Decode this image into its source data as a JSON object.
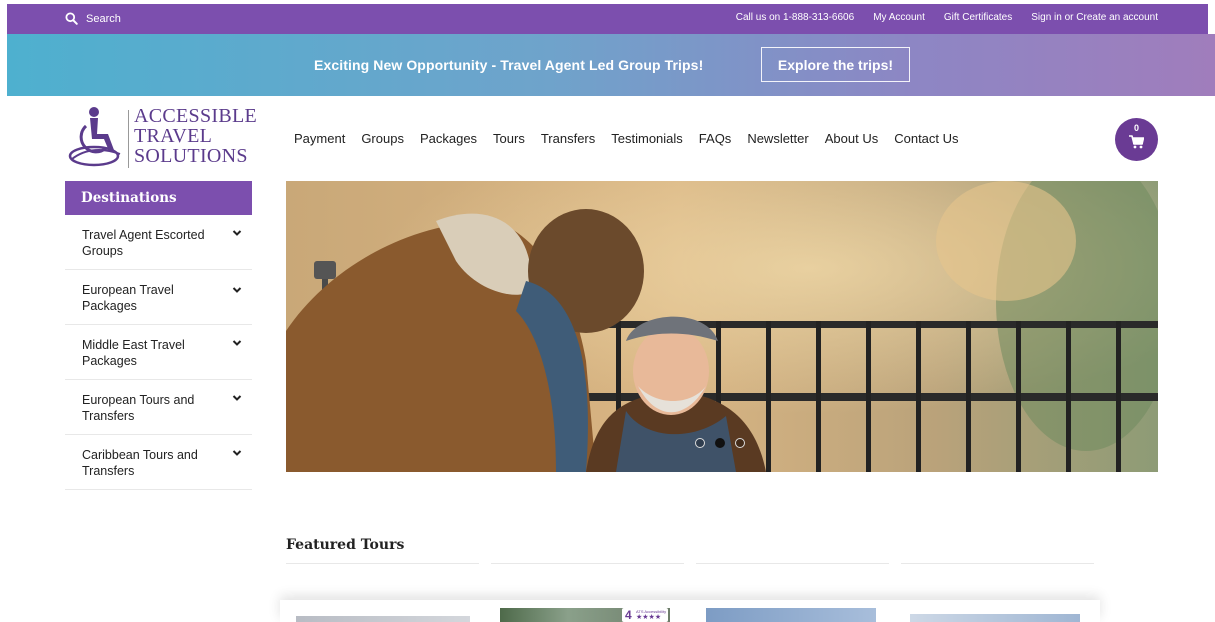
{
  "topbar": {
    "search_label": "Search",
    "phone": "Call us on 1-888-313-6606",
    "my_account": "My Account",
    "gift_certificates": "Gift Certificates",
    "sign_in": "Sign in or Create an account"
  },
  "banner": {
    "text": "Exciting New Opportunity - Travel Agent Led Group Trips!",
    "button": "Explore the trips!"
  },
  "logo": {
    "line1": "ACCESSIBLE",
    "line2": "TRAVEL",
    "line3": "SOLUTIONS"
  },
  "nav": {
    "items": [
      {
        "label": "Payment"
      },
      {
        "label": "Groups"
      },
      {
        "label": "Packages"
      },
      {
        "label": "Tours"
      },
      {
        "label": "Transfers"
      },
      {
        "label": "Testimonials"
      },
      {
        "label": "FAQs"
      },
      {
        "label": "Newsletter"
      },
      {
        "label": "About Us"
      },
      {
        "label": "Contact Us"
      }
    ]
  },
  "cart": {
    "count": "0",
    "icon": "cart-icon"
  },
  "sidebar": {
    "title": "Destinations",
    "items": [
      {
        "label": "Travel Agent Escorted Groups"
      },
      {
        "label": "European Travel Packages"
      },
      {
        "label": "Middle East Travel Packages"
      },
      {
        "label": "European Tours and Transfers"
      },
      {
        "label": "Caribbean Tours and Transfers"
      }
    ]
  },
  "hero": {
    "slide_count": 3,
    "active_slide": 2
  },
  "featured": {
    "title": "Featured Tours",
    "badge_number": "4",
    "badge_caption": "ATS Accessibility",
    "badge_stars": "★★★★"
  },
  "colors": {
    "brand_purple": "#7c4fae",
    "banner_start": "#4eb0cf",
    "banner_end": "#a07dbc"
  }
}
